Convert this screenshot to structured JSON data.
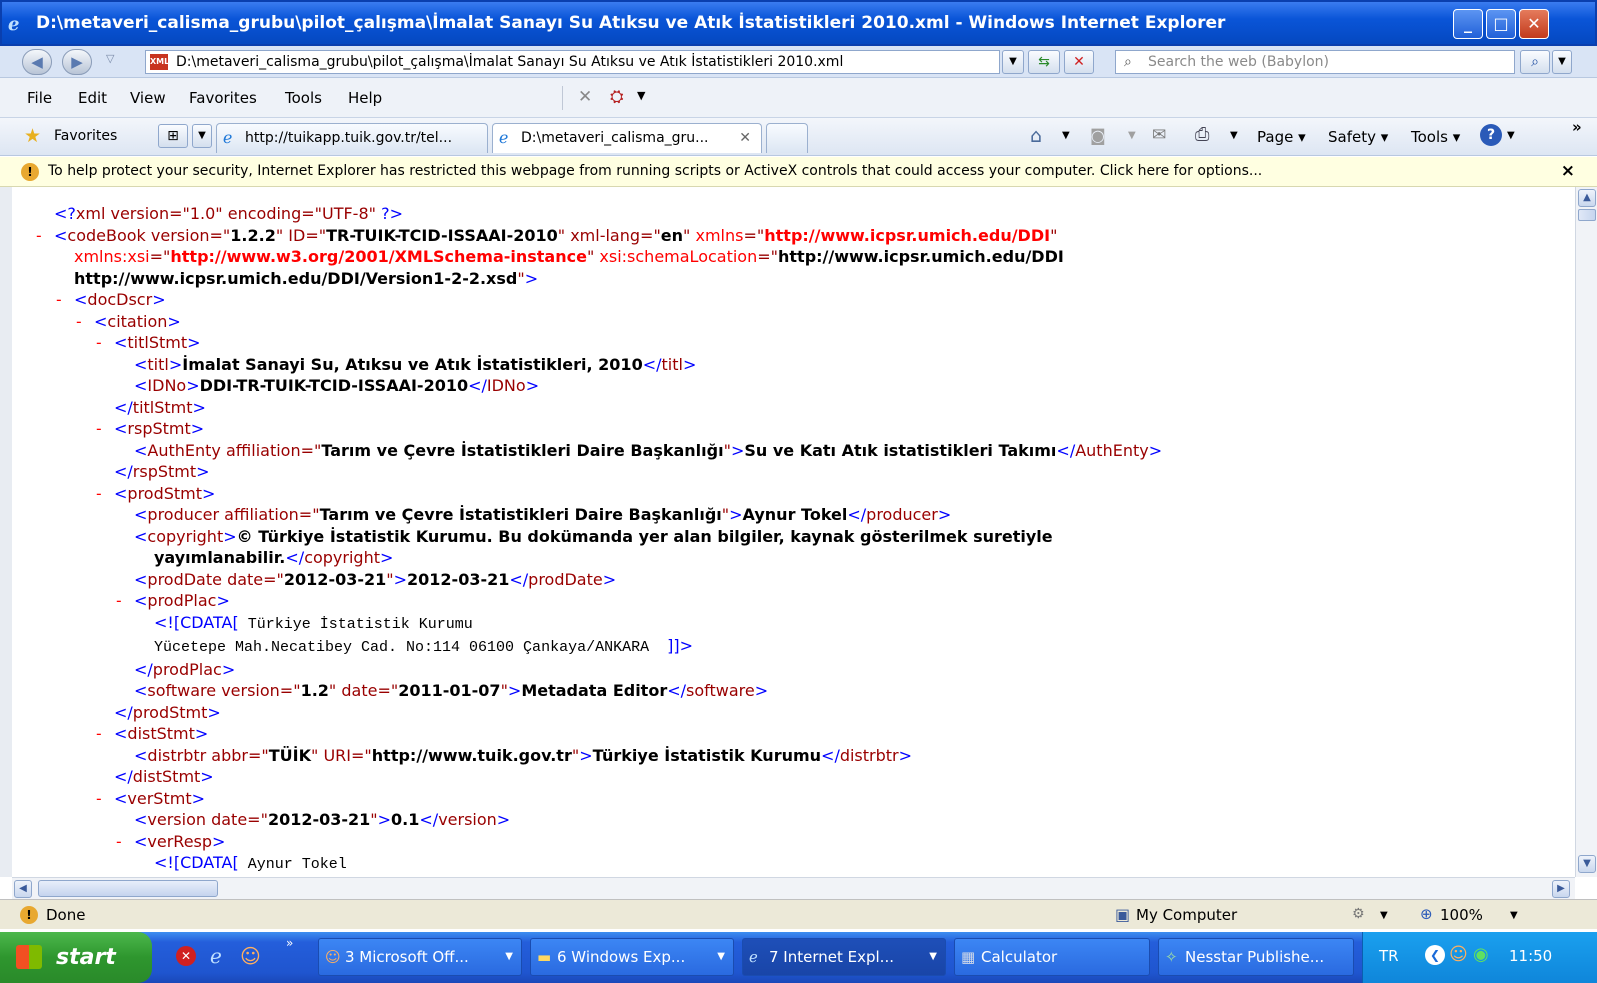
{
  "window": {
    "title": "D:\\metaveri_calisma_grubu\\pilot_çalışma\\İmalat Sanayı Su Atıksu ve Atık İstatistikleri 2010.xml - Windows Internet Explorer",
    "minimize": "_",
    "maximize": "□",
    "close": "✕"
  },
  "address": {
    "url": "D:\\metaveri_calisma_grubu\\pilot_çalışma\\İmalat Sanayı Su Atıksu ve Atık İstatistikleri 2010.xml",
    "search_placeholder": "Search the web (Babylon)"
  },
  "menu": [
    "File",
    "Edit",
    "View",
    "Favorites",
    "Tools",
    "Help"
  ],
  "favorites": {
    "label": "Favorites",
    "tabs": [
      {
        "label": "http://tuikapp.tuik.gov.tr/tel..."
      },
      {
        "label": "D:\\metaveri_calisma_gru..."
      }
    ],
    "commands": [
      "Page ▾",
      "Safety ▾",
      "Tools ▾"
    ]
  },
  "infobar": {
    "text": "To help protect your security, Internet Explorer has restricted this webpage from running scripts or ActiveX controls that could access your computer. Click here for options...",
    "close": "×"
  },
  "status": {
    "left": "Done",
    "zone": "My Computer",
    "zoom": "100%"
  },
  "taskbar": {
    "start": "start",
    "tasks": [
      {
        "label": "3 Microsoft Off..."
      },
      {
        "label": "6 Windows Exp..."
      },
      {
        "label": "7 Internet Expl..."
      },
      {
        "label": "Calculator"
      },
      {
        "label": "Nesstar Publishe..."
      }
    ],
    "lang": "TR",
    "clock": "11:50"
  },
  "xml_lines": [
    {
      "indent": 0,
      "toggle": "",
      "parts": [
        [
          "b",
          "<?"
        ],
        [
          "m",
          "xml version=\"1.0\" encoding=\"UTF-8\""
        ],
        [
          "b",
          " ?>"
        ]
      ]
    },
    {
      "indent": 0,
      "toggle": "-",
      "parts": [
        [
          "b",
          "<"
        ],
        [
          "m",
          "codeBook"
        ],
        [
          "m",
          " version=\""
        ],
        [
          "k",
          "1.2.2"
        ],
        [
          "m",
          "\" ID=\""
        ],
        [
          "k",
          "TR-TUIK-TCID-ISSAAI-2010"
        ],
        [
          "m",
          "\" xml-lang=\""
        ],
        [
          "k",
          "en"
        ],
        [
          "m",
          "\" "
        ],
        [
          "r",
          "xmlns"
        ],
        [
          "m",
          "=\""
        ],
        [
          "rk",
          "http://www.icpsr.umich.edu/DDI"
        ],
        [
          "m",
          "\""
        ]
      ]
    },
    {
      "indent": 1,
      "toggle": "",
      "parts": [
        [
          "r",
          "xmlns:xsi"
        ],
        [
          "m",
          "=\""
        ],
        [
          "rk",
          "http://www.w3.org/2001/XMLSchema-instance"
        ],
        [
          "m",
          "\" "
        ],
        [
          "r",
          "xsi:schemaLocation"
        ],
        [
          "m",
          "=\""
        ],
        [
          "k",
          "http://www.icpsr.umich.edu/DDI"
        ]
      ]
    },
    {
      "indent": 1,
      "toggle": "",
      "parts": [
        [
          "k",
          "http://www.icpsr.umich.edu/DDI/Version1-2-2.xsd"
        ],
        [
          "m",
          "\""
        ],
        [
          "b",
          ">"
        ]
      ]
    },
    {
      "indent": 1,
      "toggle": "-",
      "parts": [
        [
          "b",
          "<"
        ],
        [
          "m",
          "docDscr"
        ],
        [
          "b",
          ">"
        ]
      ]
    },
    {
      "indent": 2,
      "toggle": "-",
      "parts": [
        [
          "b",
          "<"
        ],
        [
          "m",
          "citation"
        ],
        [
          "b",
          ">"
        ]
      ]
    },
    {
      "indent": 3,
      "toggle": "-",
      "parts": [
        [
          "b",
          "<"
        ],
        [
          "m",
          "titlStmt"
        ],
        [
          "b",
          ">"
        ]
      ]
    },
    {
      "indent": 4,
      "toggle": "",
      "parts": [
        [
          "b",
          "<"
        ],
        [
          "m",
          "titl"
        ],
        [
          "b",
          ">"
        ],
        [
          "k",
          "İmalat Sanayi Su, Atıksu ve Atık İstatistikleri, 2010"
        ],
        [
          "b",
          "</"
        ],
        [
          "m",
          "titl"
        ],
        [
          "b",
          ">"
        ]
      ]
    },
    {
      "indent": 4,
      "toggle": "",
      "parts": [
        [
          "b",
          "<"
        ],
        [
          "m",
          "IDNo"
        ],
        [
          "b",
          ">"
        ],
        [
          "k",
          "DDI-TR-TUIK-TCID-ISSAAI-2010"
        ],
        [
          "b",
          "</"
        ],
        [
          "m",
          "IDNo"
        ],
        [
          "b",
          ">"
        ]
      ]
    },
    {
      "indent": 3,
      "toggle": "",
      "parts": [
        [
          "b",
          "</"
        ],
        [
          "m",
          "titlStmt"
        ],
        [
          "b",
          ">"
        ]
      ]
    },
    {
      "indent": 3,
      "toggle": "-",
      "parts": [
        [
          "b",
          "<"
        ],
        [
          "m",
          "rspStmt"
        ],
        [
          "b",
          ">"
        ]
      ]
    },
    {
      "indent": 4,
      "toggle": "",
      "parts": [
        [
          "b",
          "<"
        ],
        [
          "m",
          "AuthEnty affiliation=\""
        ],
        [
          "k",
          "Tarım ve Çevre İstatistikleri Daire Başkanlığı"
        ],
        [
          "m",
          "\""
        ],
        [
          "b",
          ">"
        ],
        [
          "k",
          "Su ve Katı Atık istatistikleri Takımı"
        ],
        [
          "b",
          "</"
        ],
        [
          "m",
          "AuthEnty"
        ],
        [
          "b",
          ">"
        ]
      ]
    },
    {
      "indent": 3,
      "toggle": "",
      "parts": [
        [
          "b",
          "</"
        ],
        [
          "m",
          "rspStmt"
        ],
        [
          "b",
          ">"
        ]
      ]
    },
    {
      "indent": 3,
      "toggle": "-",
      "parts": [
        [
          "b",
          "<"
        ],
        [
          "m",
          "prodStmt"
        ],
        [
          "b",
          ">"
        ]
      ]
    },
    {
      "indent": 4,
      "toggle": "",
      "parts": [
        [
          "b",
          "<"
        ],
        [
          "m",
          "producer affiliation=\""
        ],
        [
          "k",
          "Tarım ve Çevre İstatistikleri Daire Başkanlığı"
        ],
        [
          "m",
          "\""
        ],
        [
          "b",
          ">"
        ],
        [
          "k",
          "Aynur Tokel"
        ],
        [
          "b",
          "</"
        ],
        [
          "m",
          "producer"
        ],
        [
          "b",
          ">"
        ]
      ]
    },
    {
      "indent": 4,
      "toggle": "",
      "parts": [
        [
          "b",
          "<"
        ],
        [
          "m",
          "copyright"
        ],
        [
          "b",
          ">"
        ],
        [
          "k",
          "© Türkiye İstatistik Kurumu. Bu dokümanda yer alan bilgiler, kaynak gösterilmek suretiyle"
        ]
      ]
    },
    {
      "indent": 5,
      "toggle": "",
      "parts": [
        [
          "k",
          "yayımlanabilir."
        ],
        [
          "b",
          "</"
        ],
        [
          "m",
          "copyright"
        ],
        [
          "b",
          ">"
        ]
      ]
    },
    {
      "indent": 4,
      "toggle": "",
      "parts": [
        [
          "b",
          "<"
        ],
        [
          "m",
          "prodDate date=\""
        ],
        [
          "k",
          "2012-03-21"
        ],
        [
          "m",
          "\""
        ],
        [
          "b",
          ">"
        ],
        [
          "k",
          "2012-03-21"
        ],
        [
          "b",
          "</"
        ],
        [
          "m",
          "prodDate"
        ],
        [
          "b",
          ">"
        ]
      ]
    },
    {
      "indent": 4,
      "toggle": "-",
      "parts": [
        [
          "b",
          "<"
        ],
        [
          "m",
          "prodPlac"
        ],
        [
          "b",
          ">"
        ]
      ]
    },
    {
      "indent": 5,
      "toggle": "",
      "parts": [
        [
          "b",
          "<![CDATA["
        ],
        [
          "cd",
          " Türkiye İstatistik Kurumu"
        ]
      ]
    },
    {
      "indent": 5,
      "toggle": "",
      "parts": [
        [
          "cd",
          "Yücetepe Mah.Necatibey Cad. No:114 06100 Çankaya/ANKARA  "
        ],
        [
          "b",
          "]]>"
        ]
      ]
    },
    {
      "indent": 4,
      "toggle": "",
      "parts": [
        [
          "b",
          "</"
        ],
        [
          "m",
          "prodPlac"
        ],
        [
          "b",
          ">"
        ]
      ]
    },
    {
      "indent": 4,
      "toggle": "",
      "parts": [
        [
          "b",
          "<"
        ],
        [
          "m",
          "software version=\""
        ],
        [
          "k",
          "1.2"
        ],
        [
          "m",
          "\" date=\""
        ],
        [
          "k",
          "2011-01-07"
        ],
        [
          "m",
          "\""
        ],
        [
          "b",
          ">"
        ],
        [
          "k",
          "Metadata Editor"
        ],
        [
          "b",
          "</"
        ],
        [
          "m",
          "software"
        ],
        [
          "b",
          ">"
        ]
      ]
    },
    {
      "indent": 3,
      "toggle": "",
      "parts": [
        [
          "b",
          "</"
        ],
        [
          "m",
          "prodStmt"
        ],
        [
          "b",
          ">"
        ]
      ]
    },
    {
      "indent": 3,
      "toggle": "-",
      "parts": [
        [
          "b",
          "<"
        ],
        [
          "m",
          "distStmt"
        ],
        [
          "b",
          ">"
        ]
      ]
    },
    {
      "indent": 4,
      "toggle": "",
      "parts": [
        [
          "b",
          "<"
        ],
        [
          "m",
          "distrbtr abbr=\""
        ],
        [
          "k",
          "TÜİK"
        ],
        [
          "m",
          "\" URI=\""
        ],
        [
          "k",
          "http://www.tuik.gov.tr"
        ],
        [
          "m",
          "\""
        ],
        [
          "b",
          ">"
        ],
        [
          "k",
          "Türkiye İstatistik Kurumu"
        ],
        [
          "b",
          "</"
        ],
        [
          "m",
          "distrbtr"
        ],
        [
          "b",
          ">"
        ]
      ]
    },
    {
      "indent": 3,
      "toggle": "",
      "parts": [
        [
          "b",
          "</"
        ],
        [
          "m",
          "distStmt"
        ],
        [
          "b",
          ">"
        ]
      ]
    },
    {
      "indent": 3,
      "toggle": "-",
      "parts": [
        [
          "b",
          "<"
        ],
        [
          "m",
          "verStmt"
        ],
        [
          "b",
          ">"
        ]
      ]
    },
    {
      "indent": 4,
      "toggle": "",
      "parts": [
        [
          "b",
          "<"
        ],
        [
          "m",
          "version date=\""
        ],
        [
          "k",
          "2012-03-21"
        ],
        [
          "m",
          "\""
        ],
        [
          "b",
          ">"
        ],
        [
          "k",
          "0.1"
        ],
        [
          "b",
          "</"
        ],
        [
          "m",
          "version"
        ],
        [
          "b",
          ">"
        ]
      ]
    },
    {
      "indent": 4,
      "toggle": "-",
      "parts": [
        [
          "b",
          "<"
        ],
        [
          "m",
          "verResp"
        ],
        [
          "b",
          ">"
        ]
      ]
    },
    {
      "indent": 5,
      "toggle": "",
      "parts": [
        [
          "b",
          "<![CDATA["
        ],
        [
          "cd",
          " Aynur Tokel"
        ]
      ]
    }
  ]
}
